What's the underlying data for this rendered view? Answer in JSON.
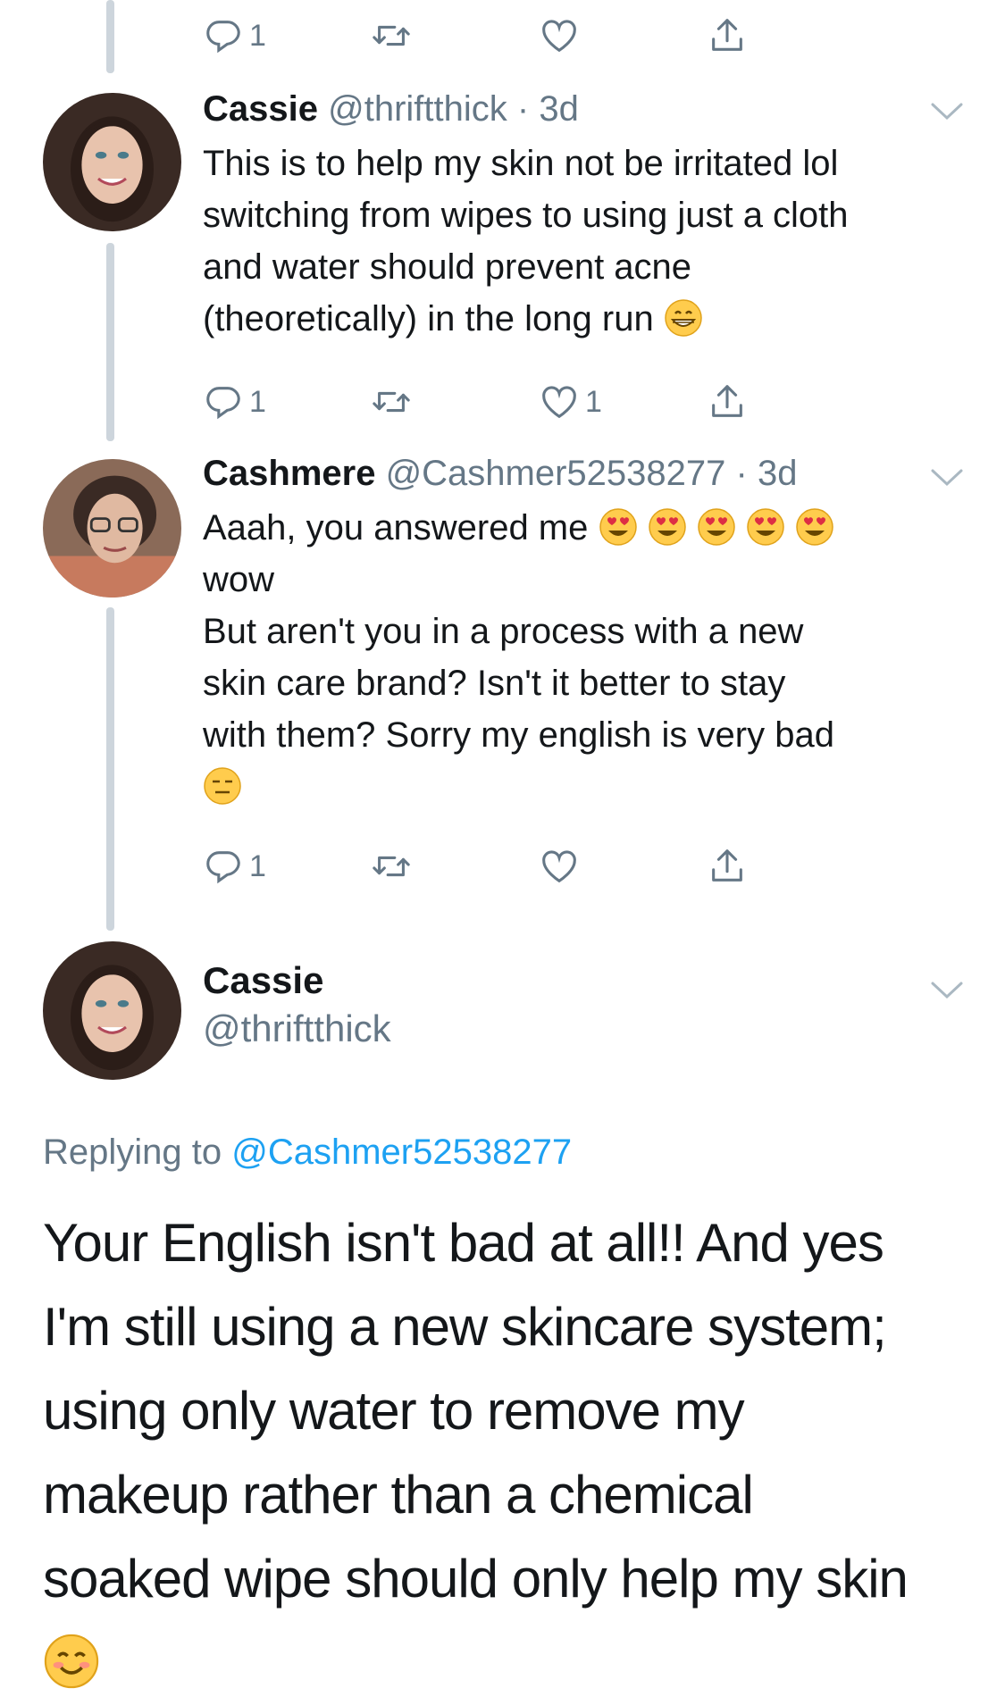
{
  "colors": {
    "text": "#14171a",
    "secondary": "#657786",
    "link": "#1da1f2",
    "thread_line": "#cdd5dc"
  },
  "top_actions": {
    "reply_count": "1",
    "like_count": ""
  },
  "tweets": [
    {
      "name": "Cassie",
      "handle": "@thriftthick",
      "separator": "·",
      "time": "3d",
      "lines": [
        "This is to help my skin not be irritated lol",
        "switching from wipes to using just a cloth",
        "and water should prevent acne",
        "(theoretically) in the long run"
      ],
      "trailing_emoji": "grinning-face-emoji",
      "reply_count": "1",
      "like_count": "1"
    },
    {
      "name": "Cashmere",
      "handle": "@Cashmer52538277",
      "separator": "·",
      "time": "3d",
      "line1": "Aaah, you answered me",
      "line1_emoji": "heart-eyes-emoji",
      "line2": "wow",
      "lines": [
        "But aren't you in a process with a new",
        "skin care brand? Isn't it better to stay",
        "with them? Sorry my english is very bad"
      ],
      "trailing_emoji": "expressionless-face-emoji",
      "reply_count": "1",
      "like_count": ""
    }
  ],
  "main_tweet": {
    "name": "Cassie",
    "handle": "@thriftthick",
    "replying_label": "Replying to",
    "replying_mention": "@Cashmer52538277",
    "lines": [
      "Your English isn't bad at all!! And yes",
      "I'm still using a new skincare system;",
      "using only water to remove my",
      "makeup rather than a chemical",
      "soaked wipe should only help my skin"
    ],
    "trailing_emoji": "smiling-face-emoji"
  }
}
